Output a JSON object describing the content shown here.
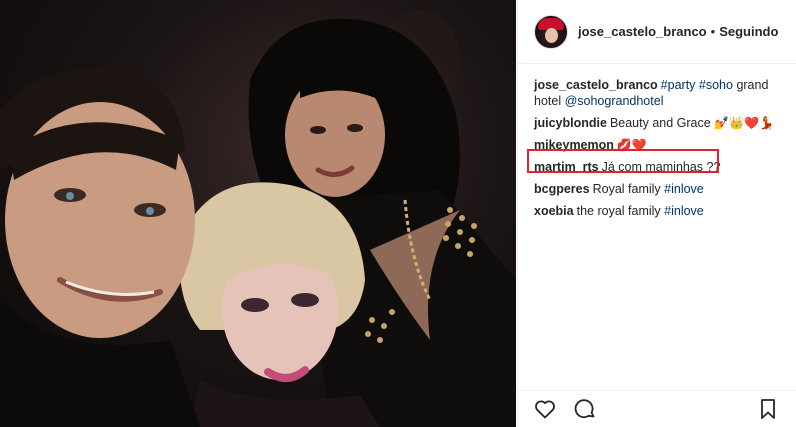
{
  "post": {
    "username": "jose_castelo_branco",
    "separator": "•",
    "follow_status": "Seguindo"
  },
  "comments": [
    {
      "user": "jose_castelo_branco",
      "parts": [
        {
          "t": "#party",
          "tag": true
        },
        {
          "t": " ",
          "tag": false
        },
        {
          "t": "#soho",
          "tag": true
        },
        {
          "t": " grand hotel ",
          "tag": false
        },
        {
          "t": "@sohograndhotel",
          "tag": true
        }
      ]
    },
    {
      "user": "juicyblondie",
      "parts": [
        {
          "t": "Beauty and Grace ",
          "tag": false
        }
      ],
      "emoji": "💅👑❤️💃"
    },
    {
      "user": "mikeymemon",
      "parts": [],
      "emoji": "💋❤️"
    },
    {
      "user": "martim_rts",
      "parts": [
        {
          "t": "Já com maminhas ??",
          "tag": false
        }
      ]
    },
    {
      "user": "bcgperes",
      "parts": [
        {
          "t": "Royal family ",
          "tag": false
        },
        {
          "t": "#inlove",
          "tag": true
        }
      ]
    },
    {
      "user": "xoebia",
      "parts": [
        {
          "t": "the royal family ",
          "tag": false
        },
        {
          "t": "#inlove",
          "tag": true
        }
      ]
    }
  ],
  "icons": {
    "like": "heart-icon",
    "comment": "comment-icon",
    "save": "bookmark-icon"
  },
  "colors": {
    "hashtag": "#003569",
    "highlight_box": "#e0242b",
    "text": "#262626"
  }
}
